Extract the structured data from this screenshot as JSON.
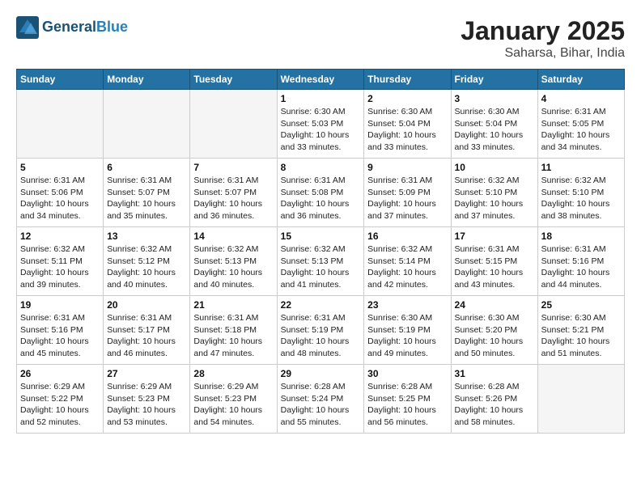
{
  "header": {
    "logo_line1": "General",
    "logo_line2": "Blue",
    "month": "January 2025",
    "location": "Saharsa, Bihar, India"
  },
  "weekdays": [
    "Sunday",
    "Monday",
    "Tuesday",
    "Wednesday",
    "Thursday",
    "Friday",
    "Saturday"
  ],
  "weeks": [
    [
      {
        "day": "",
        "info": ""
      },
      {
        "day": "",
        "info": ""
      },
      {
        "day": "",
        "info": ""
      },
      {
        "day": "1",
        "info": "Sunrise: 6:30 AM\nSunset: 5:03 PM\nDaylight: 10 hours\nand 33 minutes."
      },
      {
        "day": "2",
        "info": "Sunrise: 6:30 AM\nSunset: 5:04 PM\nDaylight: 10 hours\nand 33 minutes."
      },
      {
        "day": "3",
        "info": "Sunrise: 6:30 AM\nSunset: 5:04 PM\nDaylight: 10 hours\nand 33 minutes."
      },
      {
        "day": "4",
        "info": "Sunrise: 6:31 AM\nSunset: 5:05 PM\nDaylight: 10 hours\nand 34 minutes."
      }
    ],
    [
      {
        "day": "5",
        "info": "Sunrise: 6:31 AM\nSunset: 5:06 PM\nDaylight: 10 hours\nand 34 minutes."
      },
      {
        "day": "6",
        "info": "Sunrise: 6:31 AM\nSunset: 5:07 PM\nDaylight: 10 hours\nand 35 minutes."
      },
      {
        "day": "7",
        "info": "Sunrise: 6:31 AM\nSunset: 5:07 PM\nDaylight: 10 hours\nand 36 minutes."
      },
      {
        "day": "8",
        "info": "Sunrise: 6:31 AM\nSunset: 5:08 PM\nDaylight: 10 hours\nand 36 minutes."
      },
      {
        "day": "9",
        "info": "Sunrise: 6:31 AM\nSunset: 5:09 PM\nDaylight: 10 hours\nand 37 minutes."
      },
      {
        "day": "10",
        "info": "Sunrise: 6:32 AM\nSunset: 5:10 PM\nDaylight: 10 hours\nand 37 minutes."
      },
      {
        "day": "11",
        "info": "Sunrise: 6:32 AM\nSunset: 5:10 PM\nDaylight: 10 hours\nand 38 minutes."
      }
    ],
    [
      {
        "day": "12",
        "info": "Sunrise: 6:32 AM\nSunset: 5:11 PM\nDaylight: 10 hours\nand 39 minutes."
      },
      {
        "day": "13",
        "info": "Sunrise: 6:32 AM\nSunset: 5:12 PM\nDaylight: 10 hours\nand 40 minutes."
      },
      {
        "day": "14",
        "info": "Sunrise: 6:32 AM\nSunset: 5:13 PM\nDaylight: 10 hours\nand 40 minutes."
      },
      {
        "day": "15",
        "info": "Sunrise: 6:32 AM\nSunset: 5:13 PM\nDaylight: 10 hours\nand 41 minutes."
      },
      {
        "day": "16",
        "info": "Sunrise: 6:32 AM\nSunset: 5:14 PM\nDaylight: 10 hours\nand 42 minutes."
      },
      {
        "day": "17",
        "info": "Sunrise: 6:31 AM\nSunset: 5:15 PM\nDaylight: 10 hours\nand 43 minutes."
      },
      {
        "day": "18",
        "info": "Sunrise: 6:31 AM\nSunset: 5:16 PM\nDaylight: 10 hours\nand 44 minutes."
      }
    ],
    [
      {
        "day": "19",
        "info": "Sunrise: 6:31 AM\nSunset: 5:16 PM\nDaylight: 10 hours\nand 45 minutes."
      },
      {
        "day": "20",
        "info": "Sunrise: 6:31 AM\nSunset: 5:17 PM\nDaylight: 10 hours\nand 46 minutes."
      },
      {
        "day": "21",
        "info": "Sunrise: 6:31 AM\nSunset: 5:18 PM\nDaylight: 10 hours\nand 47 minutes."
      },
      {
        "day": "22",
        "info": "Sunrise: 6:31 AM\nSunset: 5:19 PM\nDaylight: 10 hours\nand 48 minutes."
      },
      {
        "day": "23",
        "info": "Sunrise: 6:30 AM\nSunset: 5:19 PM\nDaylight: 10 hours\nand 49 minutes."
      },
      {
        "day": "24",
        "info": "Sunrise: 6:30 AM\nSunset: 5:20 PM\nDaylight: 10 hours\nand 50 minutes."
      },
      {
        "day": "25",
        "info": "Sunrise: 6:30 AM\nSunset: 5:21 PM\nDaylight: 10 hours\nand 51 minutes."
      }
    ],
    [
      {
        "day": "26",
        "info": "Sunrise: 6:29 AM\nSunset: 5:22 PM\nDaylight: 10 hours\nand 52 minutes."
      },
      {
        "day": "27",
        "info": "Sunrise: 6:29 AM\nSunset: 5:23 PM\nDaylight: 10 hours\nand 53 minutes."
      },
      {
        "day": "28",
        "info": "Sunrise: 6:29 AM\nSunset: 5:23 PM\nDaylight: 10 hours\nand 54 minutes."
      },
      {
        "day": "29",
        "info": "Sunrise: 6:28 AM\nSunset: 5:24 PM\nDaylight: 10 hours\nand 55 minutes."
      },
      {
        "day": "30",
        "info": "Sunrise: 6:28 AM\nSunset: 5:25 PM\nDaylight: 10 hours\nand 56 minutes."
      },
      {
        "day": "31",
        "info": "Sunrise: 6:28 AM\nSunset: 5:26 PM\nDaylight: 10 hours\nand 58 minutes."
      },
      {
        "day": "",
        "info": ""
      }
    ]
  ]
}
